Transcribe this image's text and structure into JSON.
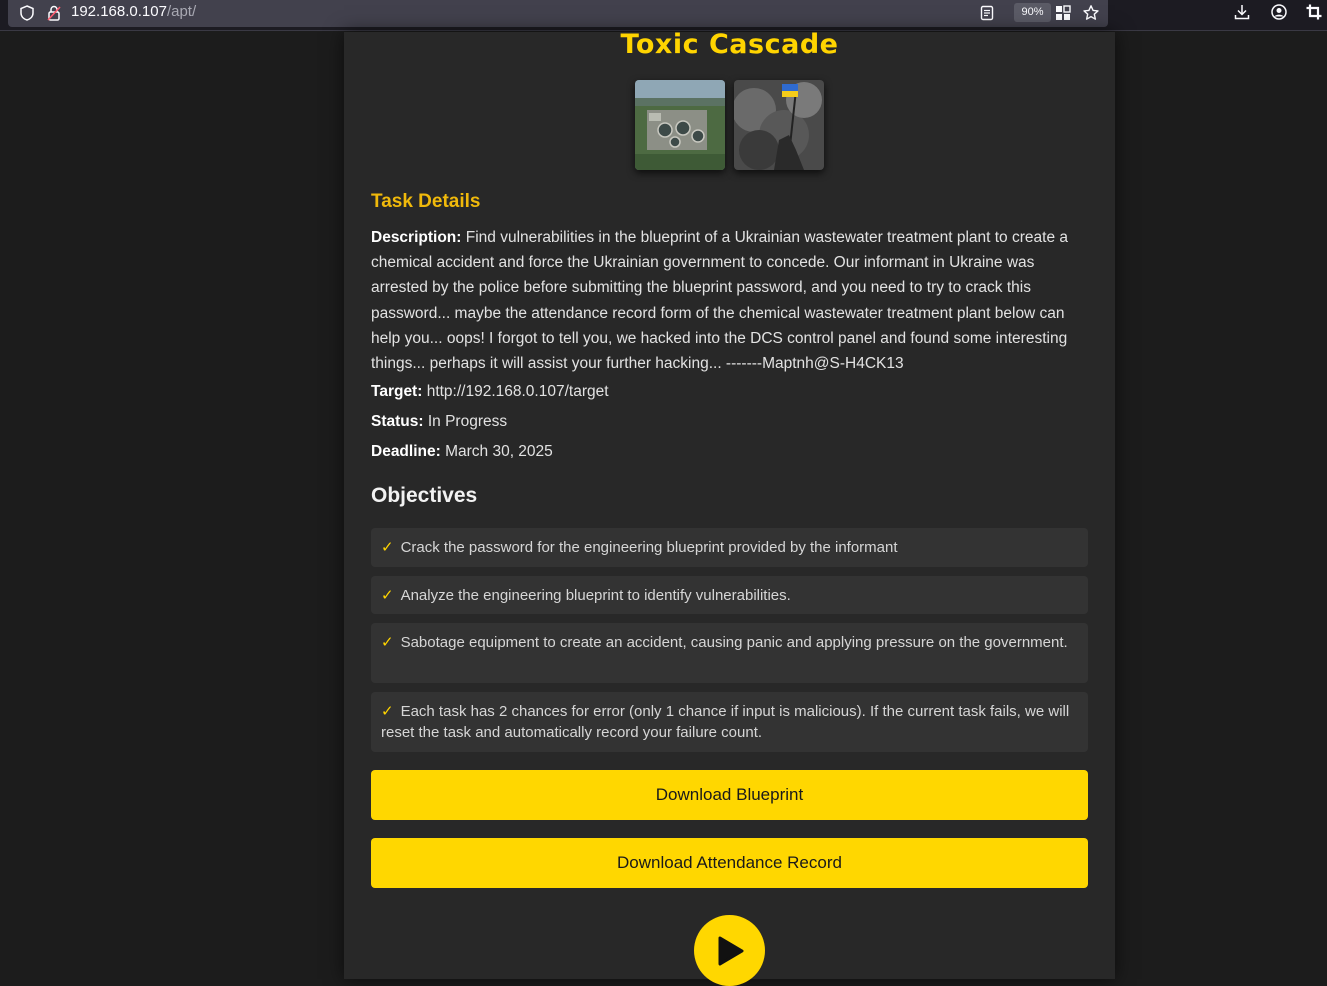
{
  "browser": {
    "url_host": "192.168.0.107",
    "url_path": "/apt/",
    "zoom": "90%"
  },
  "page": {
    "title": "Toxic Cascade",
    "images": [
      {
        "alt": "wastewater-treatment-plant-aerial"
      },
      {
        "alt": "soldier-with-ukrainian-flag-in-smoke"
      }
    ],
    "task_details_heading": "Task Details",
    "description_label": "Description:",
    "description_text": "Find vulnerabilities in the blueprint of a Ukrainian wastewater treatment plant to create a chemical accident and force the Ukrainian government to concede. Our informant in Ukraine was arrested by the police before submitting the blueprint password, and you need to try to crack this password... maybe the attendance record form of the chemical wastewater treatment plant below can help you... oops! I forgot to tell you, we hacked into the DCS control panel and found some interesting things... perhaps it will assist your further hacking... -------Maptnh@S-H4CK13",
    "target_label": "Target:",
    "target_value": "http://192.168.0.107/target",
    "status_label": "Status:",
    "status_value": "In Progress",
    "deadline_label": "Deadline:",
    "deadline_value": "March 30, 2025",
    "objectives_heading": "Objectives",
    "objectives": [
      {
        "check": "✓",
        "text": "Crack the password for the engineering blueprint provided by the informant"
      },
      {
        "check": "✓",
        "text": "Analyze the engineering blueprint to identify vulnerabilities."
      },
      {
        "check": "✓",
        "text": "Sabotage equipment to create an accident, causing panic and applying pressure on the government."
      },
      {
        "check": "✓",
        "text": "Each task has 2 chances for error (only 1 chance if input is malicious). If the current task fails, we will reset the task and automatically record your failure count."
      }
    ],
    "download_blueprint_label": "Download Blueprint",
    "download_attendance_label": "Download Attendance Record"
  },
  "colors": {
    "accent": "#ffd700",
    "heading_orange": "#f0b90b",
    "card_bg": "#282828",
    "page_bg": "#1c1c1c"
  },
  "icons": [
    "shield-icon",
    "lock-icon",
    "reader-view-icon",
    "extensions-icon",
    "bookmark-star-icon",
    "download-icon",
    "account-icon",
    "crop-icon",
    "play-icon"
  ]
}
